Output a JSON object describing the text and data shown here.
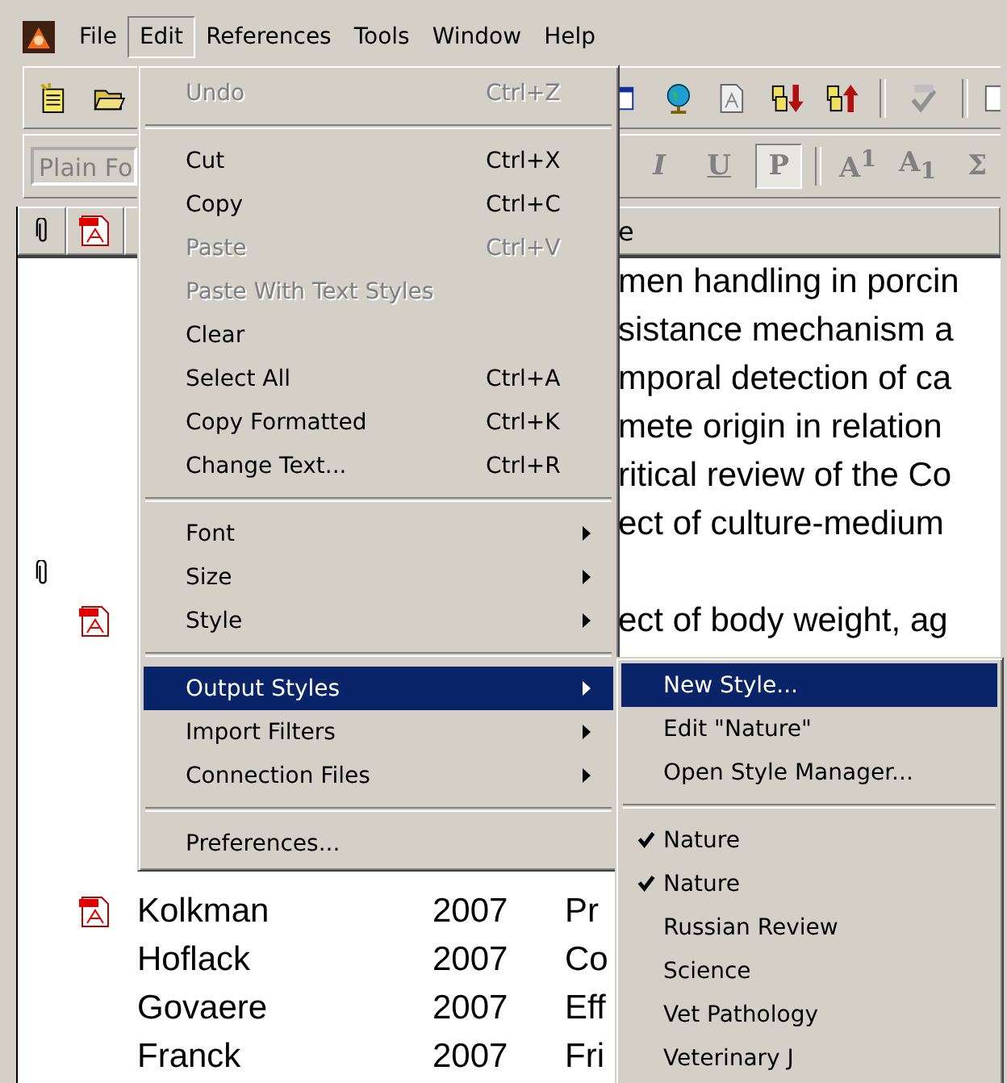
{
  "menubar": [
    {
      "label": "File",
      "selected": false
    },
    {
      "label": "Edit",
      "selected": true
    },
    {
      "label": "References",
      "selected": false
    },
    {
      "label": "Tools",
      "selected": false
    },
    {
      "label": "Window",
      "selected": false
    },
    {
      "label": "Help",
      "selected": false
    }
  ],
  "toolbar": {
    "font_field": {
      "value": "Plain Fo"
    },
    "format_buttons": [
      {
        "label": "I",
        "kind": "italic",
        "pressed": false
      },
      {
        "label": "U",
        "kind": "underline",
        "pressed": false
      },
      {
        "label": "P",
        "kind": "plain",
        "pressed": true
      },
      {
        "label": "A$^{1}$",
        "kind": "rich",
        "pressed": false
      },
      {
        "label": "A$_{1}$",
        "kind": "rich",
        "pressed": false
      },
      {
        "label": "Σ",
        "kind": "plain",
        "pressed": false
      }
    ]
  },
  "table": {
    "title_heading": "e",
    "rows": [
      {
        "attachment": false,
        "pdf": false,
        "title": "men handling in porcin"
      },
      {
        "attachment": false,
        "pdf": false,
        "title": "sistance mechanism a"
      },
      {
        "attachment": false,
        "pdf": false,
        "title": "mporal detection of ca"
      },
      {
        "attachment": false,
        "pdf": false,
        "title": "mete origin in relation"
      },
      {
        "attachment": false,
        "pdf": false,
        "title": "ritical review of the Co"
      },
      {
        "attachment": false,
        "pdf": false,
        "title": "ect of culture-medium"
      },
      {
        "attachment": true,
        "pdf": false
      },
      {
        "attachment": false,
        "pdf": true,
        "title": "ect of body weight, ag"
      },
      {
        "attachment": false,
        "pdf": false
      },
      {
        "attachment": false,
        "pdf": false
      },
      {
        "attachment": false,
        "pdf": false
      },
      {
        "attachment": false,
        "pdf": false
      },
      {
        "attachment": false,
        "pdf": false
      },
      {
        "attachment": false,
        "pdf": true,
        "author": "Kolkman",
        "year": "2007",
        "title": "Pr"
      },
      {
        "attachment": false,
        "pdf": false,
        "author": "Hoflack",
        "year": "2007",
        "title": "Co"
      },
      {
        "attachment": false,
        "pdf": false,
        "author": "Govaere",
        "year": "2007",
        "title": "Eff"
      },
      {
        "attachment": false,
        "pdf": false,
        "author": "Franck",
        "year": "2007",
        "title": "Fri"
      }
    ]
  },
  "edit_menu": [
    {
      "kind": "item",
      "label": "Undo",
      "shortcut": "Ctrl+Z",
      "disabled": true,
      "submenu": false,
      "selected": false
    },
    {
      "kind": "separator"
    },
    {
      "kind": "item",
      "label": "Cut",
      "shortcut": "Ctrl+X",
      "disabled": false,
      "submenu": false,
      "selected": false
    },
    {
      "kind": "item",
      "label": "Copy",
      "shortcut": "Ctrl+C",
      "disabled": false,
      "submenu": false,
      "selected": false
    },
    {
      "kind": "item",
      "label": "Paste",
      "shortcut": "Ctrl+V",
      "disabled": true,
      "submenu": false,
      "selected": false
    },
    {
      "kind": "item",
      "label": "Paste With Text Styles",
      "disabled": true,
      "submenu": false,
      "selected": false
    },
    {
      "kind": "item",
      "label": "Clear",
      "disabled": false,
      "submenu": false,
      "selected": false
    },
    {
      "kind": "item",
      "label": "Select All",
      "shortcut": "Ctrl+A",
      "disabled": false,
      "submenu": false,
      "selected": false
    },
    {
      "kind": "item",
      "label": "Copy Formatted",
      "shortcut": "Ctrl+K",
      "disabled": false,
      "submenu": false,
      "selected": false
    },
    {
      "kind": "item",
      "label": "Change Text...",
      "shortcut": "Ctrl+R",
      "disabled": false,
      "submenu": false,
      "selected": false
    },
    {
      "kind": "separator"
    },
    {
      "kind": "item",
      "label": "Font",
      "disabled": false,
      "submenu": true,
      "selected": false
    },
    {
      "kind": "item",
      "label": "Size",
      "disabled": false,
      "submenu": true,
      "selected": false
    },
    {
      "kind": "item",
      "label": "Style",
      "disabled": false,
      "submenu": true,
      "selected": false
    },
    {
      "kind": "separator"
    },
    {
      "kind": "item",
      "label": "Output Styles",
      "disabled": false,
      "submenu": true,
      "selected": true
    },
    {
      "kind": "item",
      "label": "Import Filters",
      "disabled": false,
      "submenu": true,
      "selected": false
    },
    {
      "kind": "item",
      "label": "Connection Files",
      "disabled": false,
      "submenu": true,
      "selected": false
    },
    {
      "kind": "separator"
    },
    {
      "kind": "item",
      "label": "Preferences...",
      "disabled": false,
      "submenu": false,
      "selected": false
    }
  ],
  "output_styles_menu": [
    {
      "kind": "item",
      "label": "New Style...",
      "checked": false,
      "selected": true
    },
    {
      "kind": "item",
      "label": "Edit \"Nature\"",
      "checked": false,
      "selected": false
    },
    {
      "kind": "item",
      "label": "Open Style Manager...",
      "checked": false,
      "selected": false
    },
    {
      "kind": "separator"
    },
    {
      "kind": "item",
      "label": "Nature",
      "checked": true,
      "selected": false
    },
    {
      "kind": "item",
      "label": "Nature",
      "checked": true,
      "selected": false
    },
    {
      "kind": "item",
      "label": "Russian Review",
      "checked": false,
      "selected": false
    },
    {
      "kind": "item",
      "label": "Science",
      "checked": false,
      "selected": false
    },
    {
      "kind": "item",
      "label": "Vet Pathology",
      "checked": false,
      "selected": false
    },
    {
      "kind": "item",
      "label": "Veterinary J",
      "checked": false,
      "selected": false
    }
  ]
}
